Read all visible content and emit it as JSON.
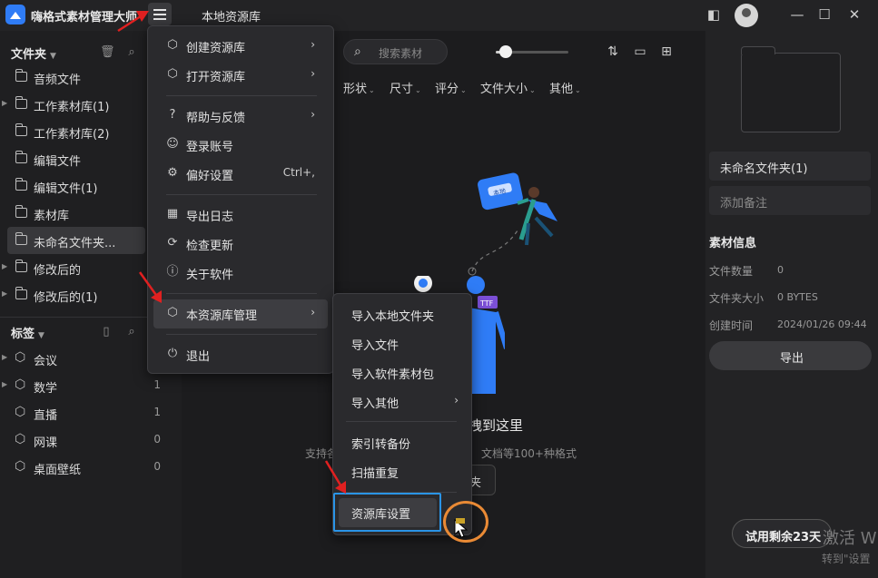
{
  "app": {
    "title": "嗨格式素材管理大师",
    "library_title": "本地资源库"
  },
  "sidebar": {
    "folders_header": "文件夹",
    "folders": [
      {
        "label": "音频文件",
        "expandable": false
      },
      {
        "label": "工作素材库(1)",
        "expandable": true
      },
      {
        "label": "工作素材库(2)",
        "expandable": false
      },
      {
        "label": "编辑文件",
        "expandable": false
      },
      {
        "label": "编辑文件(1)",
        "expandable": false
      },
      {
        "label": "素材库",
        "expandable": false
      },
      {
        "label": "未命名文件夹...",
        "expandable": false,
        "active": true
      },
      {
        "label": "修改后的",
        "expandable": true
      },
      {
        "label": "修改后的(1)",
        "expandable": true
      }
    ],
    "tags_header": "标签",
    "tags": [
      {
        "label": "会议",
        "count": ""
      },
      {
        "label": "数学",
        "count": "1"
      },
      {
        "label": "直播",
        "count": "1"
      },
      {
        "label": "网课",
        "count": "0"
      },
      {
        "label": "桌面壁纸",
        "count": "0"
      }
    ]
  },
  "toolbar": {
    "search_placeholder": "搜索素材",
    "zoom_level": 0.15,
    "filters": [
      "形状",
      "尺寸",
      "评分",
      "文件大小",
      "其他"
    ]
  },
  "empty_state": {
    "title_partial": "拽到这里",
    "subtitle_left": "支持各",
    "subtitle_right": "文档等100+种格式",
    "button_partial": "夹",
    "illustration_badge": "本地"
  },
  "main_menu": {
    "items": [
      {
        "icon": "cube-icon",
        "label": "创建资源库",
        "shortcut": "",
        "submenu": true
      },
      {
        "icon": "cube-icon",
        "label": "打开资源库",
        "shortcut": "",
        "submenu": true
      },
      {
        "icon": "help-icon",
        "label": "帮助与反馈",
        "shortcut": "",
        "submenu": true
      },
      {
        "icon": "user-icon",
        "label": "登录账号",
        "shortcut": "",
        "submenu": false
      },
      {
        "icon": "gear-icon",
        "label": "偏好设置",
        "shortcut": "Ctrl+,",
        "submenu": false
      },
      {
        "icon": "calendar-icon",
        "label": "导出日志",
        "shortcut": "",
        "submenu": false
      },
      {
        "icon": "update-icon",
        "label": "检查更新",
        "shortcut": "",
        "submenu": false
      },
      {
        "icon": "info-icon",
        "label": "关于软件",
        "shortcut": "",
        "submenu": false
      },
      {
        "icon": "cube-icon",
        "label": "本资源库管理",
        "shortcut": "",
        "submenu": true
      },
      {
        "icon": "exit-icon",
        "label": "退出",
        "shortcut": "",
        "submenu": false
      }
    ]
  },
  "sub_menu": {
    "items": [
      {
        "label": "导入本地文件夹",
        "submenu": false
      },
      {
        "label": "导入文件",
        "submenu": false
      },
      {
        "label": "导入软件素材包",
        "submenu": false
      },
      {
        "label": "导入其他",
        "submenu": true
      },
      {
        "label": "索引转备份",
        "submenu": false
      },
      {
        "label": "扫描重复",
        "submenu": false
      },
      {
        "label": "资源库设置",
        "submenu": false
      }
    ]
  },
  "right_panel": {
    "folder_name": "未命名文件夹(1)",
    "note_placeholder": "添加备注",
    "info_title": "素材信息",
    "info": [
      {
        "key": "文件数量",
        "value": "0"
      },
      {
        "key": "文件夹大小",
        "value": "0 BYTES"
      },
      {
        "key": "创建时间",
        "value": "2024/01/26 09:44"
      }
    ],
    "export_label": "导出",
    "trial_label": "试用剩余23天",
    "watermark_line1": "激活 W",
    "watermark_line2": "转到\"设置"
  },
  "colors": {
    "accent_blue": "#2a94e6",
    "annotation_red": "#e02020",
    "annotation_orange": "#e98a35",
    "logo_blue": "#2f7cf6"
  }
}
